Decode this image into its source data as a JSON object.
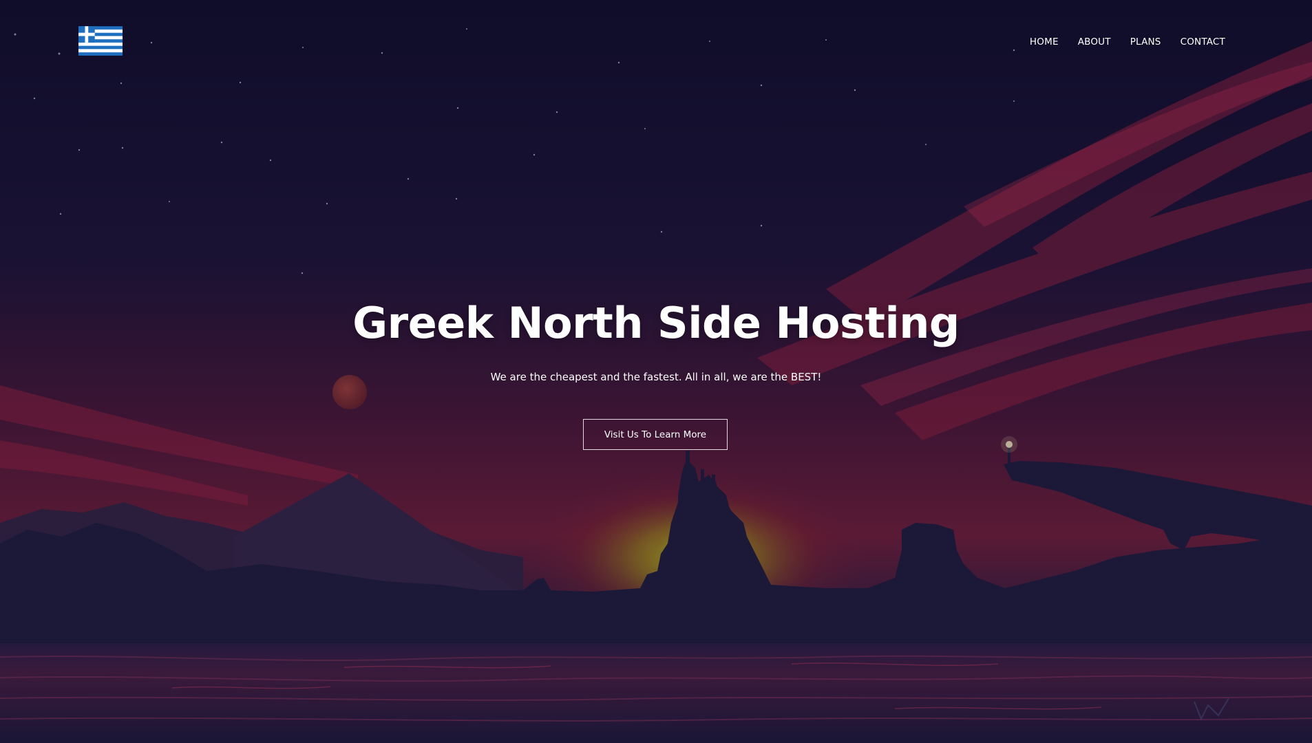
{
  "header": {
    "logo_icon": "greek-flag-icon",
    "nav": [
      {
        "label": "HOME"
      },
      {
        "label": "ABOUT"
      },
      {
        "label": "PLANS"
      },
      {
        "label": "CONTACT"
      }
    ]
  },
  "hero": {
    "title": "Greek North Side Hosting",
    "subtitle": "We are the cheapest and the fastest. All in all, we are the BEST!",
    "cta_label": "Visit Us To Learn More",
    "background_icon": "night-landscape-illustration"
  },
  "colors": {
    "sky_top": "#120f2e",
    "sky_mid": "#3a1330",
    "horizon_glow": "#7a8a1c",
    "silhouette": "#1b1838",
    "text": "#ffffff",
    "flag_blue": "#1f6fc0"
  }
}
